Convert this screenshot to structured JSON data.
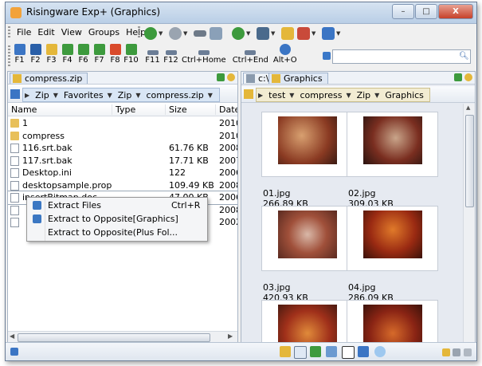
{
  "window": {
    "title": "Risingware Exp+  (Graphics)",
    "minimize": "–",
    "maximize": "□",
    "close": "X"
  },
  "menu": [
    "File",
    "Edit",
    "View",
    "Groups",
    "Help"
  ],
  "fkeys": [
    {
      "label": "F1",
      "color": "#3b75c4"
    },
    {
      "label": "F2",
      "color": "#2a5fa8"
    },
    {
      "label": "F3",
      "color": "#e4b73a"
    },
    {
      "label": "F4",
      "color": "#3d9a3d"
    },
    {
      "label": "F6",
      "color": "#3d9a3d"
    },
    {
      "label": "F7",
      "color": "#3d9a3d"
    },
    {
      "label": "F8",
      "color": "#d94a2a"
    },
    {
      "label": "F10",
      "color": "#3d9a3d"
    },
    {
      "label": "F11",
      "color": "#6b7d96"
    },
    {
      "label": "F12",
      "color": "#6b7d96"
    },
    {
      "label": "Ctrl+Home",
      "color": "#6b7d96"
    },
    {
      "label": "Ctrl+End",
      "color": "#6b7d96"
    },
    {
      "label": "Alt+O",
      "color": "#3b75c4"
    }
  ],
  "search": {
    "value": ""
  },
  "left_pane": {
    "tab": "compress.zip",
    "breadcrumb": [
      "Zip",
      "Favorites",
      "Zip",
      "compress.zip"
    ],
    "columns": [
      "Name",
      "Type",
      "Size",
      "Date"
    ],
    "files": [
      {
        "name": "1",
        "type": "",
        "size": "",
        "date": "2010",
        "kind": "folder"
      },
      {
        "name": "compress",
        "type": "",
        "size": "",
        "date": "2010",
        "kind": "folder"
      },
      {
        "name": "116.srt.bak",
        "type": "",
        "size": "61.76 KB",
        "date": "2008",
        "kind": "file"
      },
      {
        "name": "117.srt.bak",
        "type": "",
        "size": "17.71 KB",
        "date": "2007",
        "kind": "file"
      },
      {
        "name": "Desktop.ini",
        "type": "",
        "size": "122",
        "date": "2006",
        "kind": "file"
      },
      {
        "name": "desktopsample.properti...",
        "type": "",
        "size": "109.49 KB",
        "date": "2008",
        "kind": "file"
      },
      {
        "name": "insertBitmap.doc",
        "type": "",
        "size": "47.00 KB",
        "date": "2006",
        "kind": "file"
      },
      {
        "name": "",
        "type": "",
        "size": "",
        "date": "2008",
        "kind": "file"
      },
      {
        "name": "",
        "type": "",
        "size": "",
        "date": "2002",
        "kind": "file"
      }
    ]
  },
  "context_menu": [
    {
      "label": "Extract Files",
      "shortcut": "Ctrl+R"
    },
    {
      "label": "Extract to Opposite[Graphics]",
      "shortcut": ""
    },
    {
      "label": "Extract to Opposite(Plus Fol...",
      "shortcut": ""
    }
  ],
  "right_pane": {
    "tab_drive": "c:\\",
    "tab": "Graphics",
    "breadcrumb": [
      "test",
      "compress",
      "Zip",
      "Graphics"
    ],
    "thumbnails": [
      {
        "name": "01.jpg",
        "size": "266.89 KB"
      },
      {
        "name": "02.jpg",
        "size": "309.03 KB"
      },
      {
        "name": "03.jpg",
        "size": "420.93 KB"
      },
      {
        "name": "04.jpg",
        "size": "286.09 KB"
      },
      {
        "name": "",
        "size": ""
      },
      {
        "name": "",
        "size": ""
      }
    ]
  }
}
